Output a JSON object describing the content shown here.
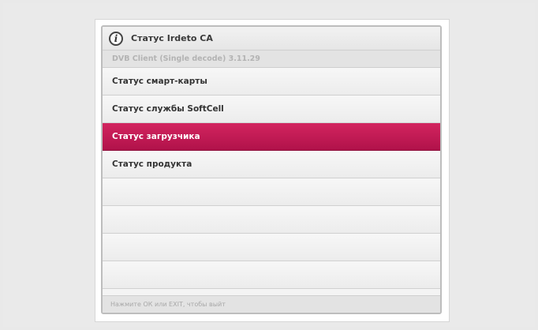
{
  "dialog": {
    "title": "Статус Irdeto CA",
    "subtitle": "DVB Client (Single decode) 3.11.29",
    "icon": "info-icon"
  },
  "menu": {
    "items": [
      {
        "label": "Статус смарт-карты",
        "selected": false
      },
      {
        "label": "Статус службы SoftCell",
        "selected": false
      },
      {
        "label": "Статус загрузчика",
        "selected": true
      },
      {
        "label": "Статус продукта",
        "selected": false
      }
    ],
    "empty_rows": 4
  },
  "footer": {
    "hint": "Нажмите ОК или EXIT, чтобы выйт"
  },
  "colors": {
    "selected": "#c41a55",
    "background": "#e9e9e9",
    "window": "#f4f4f4"
  }
}
